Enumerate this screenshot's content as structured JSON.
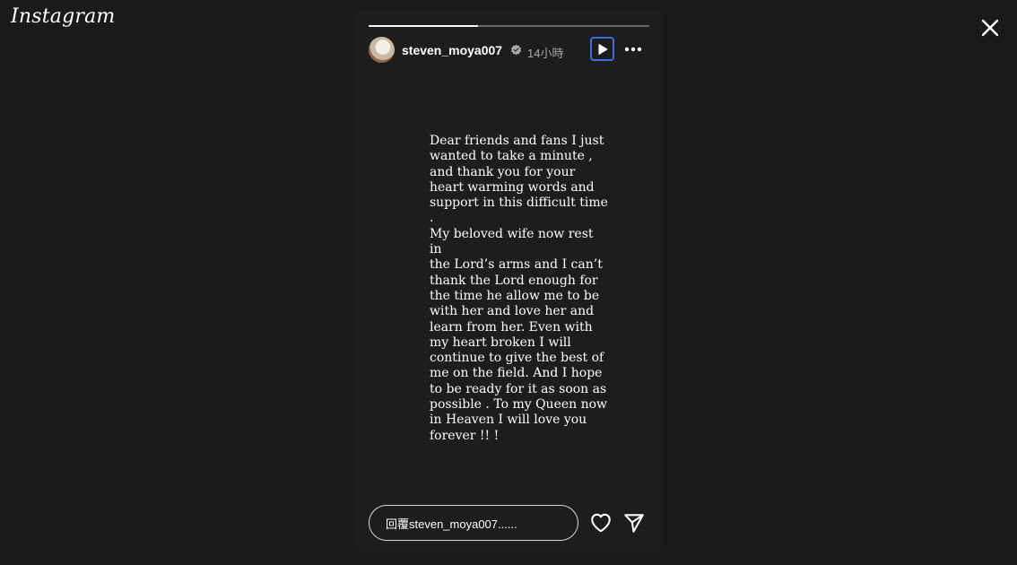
{
  "app": {
    "logo_text": "Instagram"
  },
  "story": {
    "progress_fraction": 0.39,
    "username": "steven_moya007",
    "verified": true,
    "time_ago": "14小時",
    "text": "Dear friends and fans I just\nwanted to take a minute ,\nand thank you for your\nheart warming words and\nsupport in this difficult time .\nMy beloved wife now rest in\nthe Lord’s arms and I can’t\nthank the Lord enough for\nthe time he allow me to be\nwith her and love her and\nlearn from her. Even with\nmy heart broken I will\ncontinue to give the best of\nme on the field. And I hope\nto be ready for it as soon as\npossible . To my Queen now\nin Heaven I will love you\nforever !! !"
  },
  "reply": {
    "placeholder": "回覆steven_moya007......"
  },
  "icons": {
    "close": "close-icon",
    "play": "play-icon",
    "more": "more-horizontal-icon",
    "heart": "heart-icon",
    "send": "send-icon",
    "verified": "verified-badge-icon"
  },
  "colors": {
    "background": "#1a1a1a",
    "story_panel": "#1d1d1d",
    "focus_outline": "#3b6fe0",
    "muted_text": "#a8a8a8"
  }
}
